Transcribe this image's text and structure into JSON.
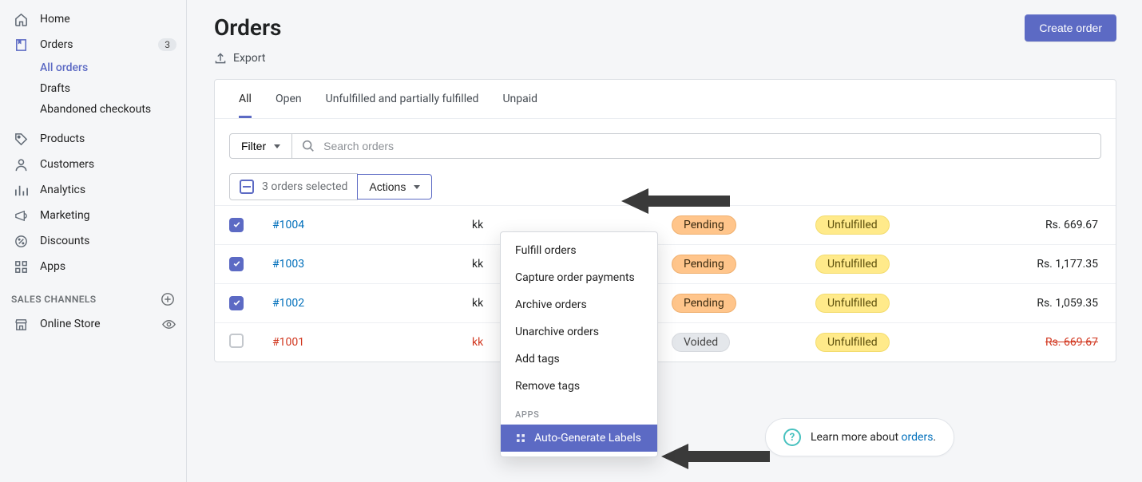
{
  "sidebar": {
    "items": [
      {
        "icon": "home",
        "label": "Home"
      },
      {
        "icon": "orders",
        "label": "Orders",
        "badge": "3",
        "active": true
      },
      {
        "icon": "products",
        "label": "Products"
      },
      {
        "icon": "customers",
        "label": "Customers"
      },
      {
        "icon": "analytics",
        "label": "Analytics"
      },
      {
        "icon": "marketing",
        "label": "Marketing"
      },
      {
        "icon": "discounts",
        "label": "Discounts"
      },
      {
        "icon": "apps",
        "label": "Apps"
      }
    ],
    "sub": [
      {
        "label": "All orders",
        "active": true
      },
      {
        "label": "Drafts"
      },
      {
        "label": "Abandoned checkouts"
      }
    ],
    "channels_label": "SALES CHANNELS",
    "channel_item": "Online Store"
  },
  "header": {
    "title": "Orders",
    "export": "Export",
    "cta": "Create order"
  },
  "tabs": [
    "All",
    "Open",
    "Unfulfilled and partially fulfilled",
    "Unpaid"
  ],
  "active_tab": 0,
  "filter_label": "Filter",
  "search_placeholder": "Search orders",
  "bulk": {
    "selected": "3 orders selected",
    "actions": "Actions"
  },
  "orders": [
    {
      "id": "#1004",
      "customer": "kk",
      "payment": "Pending",
      "fulfillment": "Unfulfilled",
      "amount": "Rs. 669.67",
      "checked": true
    },
    {
      "id": "#1003",
      "customer": "kk",
      "payment": "Pending",
      "fulfillment": "Unfulfilled",
      "amount": "Rs. 1,177.35",
      "checked": true
    },
    {
      "id": "#1002",
      "customer": "kk",
      "payment": "Pending",
      "fulfillment": "Unfulfilled",
      "amount": "Rs. 1,059.35",
      "checked": true
    },
    {
      "id": "#1001",
      "customer": "kk",
      "payment": "Voided",
      "fulfillment": "Unfulfilled",
      "amount": "Rs. 669.67",
      "checked": false,
      "voided": true
    }
  ],
  "dropdown": {
    "items": [
      "Fulfill orders",
      "Capture order payments",
      "Archive orders",
      "Unarchive orders",
      "Add tags",
      "Remove tags"
    ],
    "apps_label": "APPS",
    "app_item": "Auto-Generate Labels"
  },
  "learn": {
    "text": "Learn more about ",
    "link": "orders",
    "tail": "."
  }
}
